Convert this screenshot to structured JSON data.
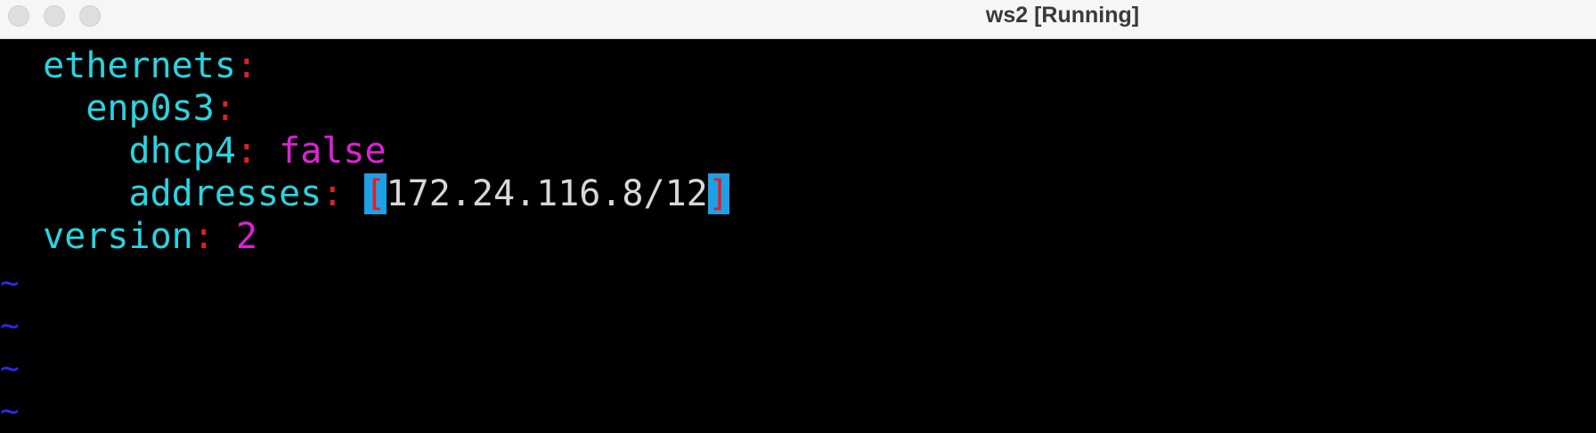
{
  "window": {
    "title": "ws2 [Running]"
  },
  "editor": {
    "lines": [
      {
        "indent": "  ",
        "key": "ethernets",
        "colon": ":"
      },
      {
        "indent": "    ",
        "key": "enp0s3",
        "colon": ":"
      },
      {
        "indent": "      ",
        "key": "dhcp4",
        "colon": ":",
        "value": "false"
      },
      {
        "indent": "      ",
        "key": "addresses",
        "colon": ":",
        "open_bracket": "[",
        "address": "172.24.116.8/12",
        "close_bracket": "]"
      },
      {
        "indent": "  ",
        "key": "version",
        "colon": ":",
        "value": "2"
      }
    ],
    "empty_line_marker": "~"
  },
  "colors": {
    "key": "#2ad4e0",
    "punctuation": "#e02020",
    "literal": "#e020d8",
    "text": "#d8d8d8",
    "highlight": "#1ea0e6",
    "tilde": "#2b2bff"
  }
}
